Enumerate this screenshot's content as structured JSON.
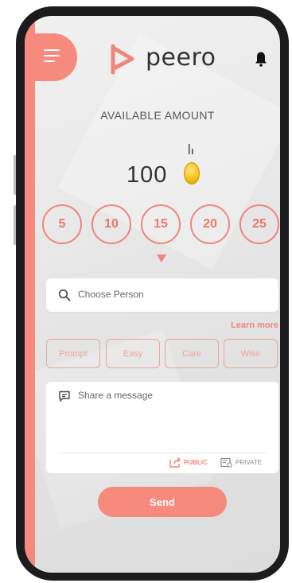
{
  "header": {
    "brand_name": "peero",
    "menu_icon": "hamburger-menu-icon",
    "notification_icon": "bell-icon",
    "accent_color": "#f58a7d"
  },
  "balance": {
    "label": "AVAILABLE AMOUNT",
    "value": "100",
    "currency_icon": "gold-coin-icon"
  },
  "amount_options": [
    "5",
    "10",
    "15",
    "20",
    "25"
  ],
  "search": {
    "placeholder": "Choose Person"
  },
  "learn_more": "Learn more",
  "tags": [
    "Prompt",
    "Easy",
    "Care",
    "Wise"
  ],
  "message": {
    "placeholder": "Share a message",
    "public_label": "PUBLIC",
    "private_label": "PRIVATE"
  },
  "send_label": "Send"
}
